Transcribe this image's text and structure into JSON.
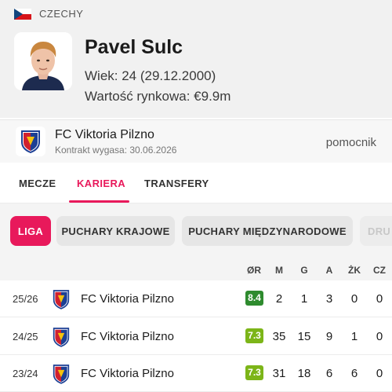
{
  "header": {
    "country": "CZECHY",
    "player_name": "Pavel Sulc",
    "age_line": "Wiek: 24 (29.12.2000)",
    "value_line": "Wartość rynkowa: €9.9m"
  },
  "club": {
    "name": "FC Viktoria Pilzno",
    "contract": "Kontrakt wygasa: 30.06.2026",
    "position": "pomocnik"
  },
  "tabs": [
    {
      "label": "MECZE"
    },
    {
      "label": "KARIERA"
    },
    {
      "label": "TRANSFERY"
    }
  ],
  "active_tab": "KARIERA",
  "filters": [
    {
      "label": "LIGA"
    },
    {
      "label": "PUCHARY KRAJOWE"
    },
    {
      "label": "PUCHARY MIĘDZYNARODOWE"
    },
    {
      "label": "DRU"
    }
  ],
  "active_filter": "LIGA",
  "table": {
    "columns": [
      "ØR",
      "M",
      "G",
      "A",
      "ŻK",
      "CZ"
    ],
    "rows": [
      {
        "season": "25/26",
        "club": "FC Viktoria Pilzno",
        "rating": "8.4",
        "rating_color": "#2e8b2e",
        "m": "2",
        "g": "1",
        "a": "3",
        "zk": "0",
        "cz": "0"
      },
      {
        "season": "24/25",
        "club": "FC Viktoria Pilzno",
        "rating": "7.3",
        "rating_color": "#7cb518",
        "m": "35",
        "g": "15",
        "a": "9",
        "zk": "1",
        "cz": "0"
      },
      {
        "season": "23/24",
        "club": "FC Viktoria Pilzno",
        "rating": "7.3",
        "rating_color": "#7cb518",
        "m": "31",
        "g": "18",
        "a": "6",
        "zk": "6",
        "cz": "0"
      }
    ]
  },
  "colors": {
    "accent": "#e8195b",
    "rating_high": "#2e8b2e",
    "rating_good": "#7cb518"
  }
}
